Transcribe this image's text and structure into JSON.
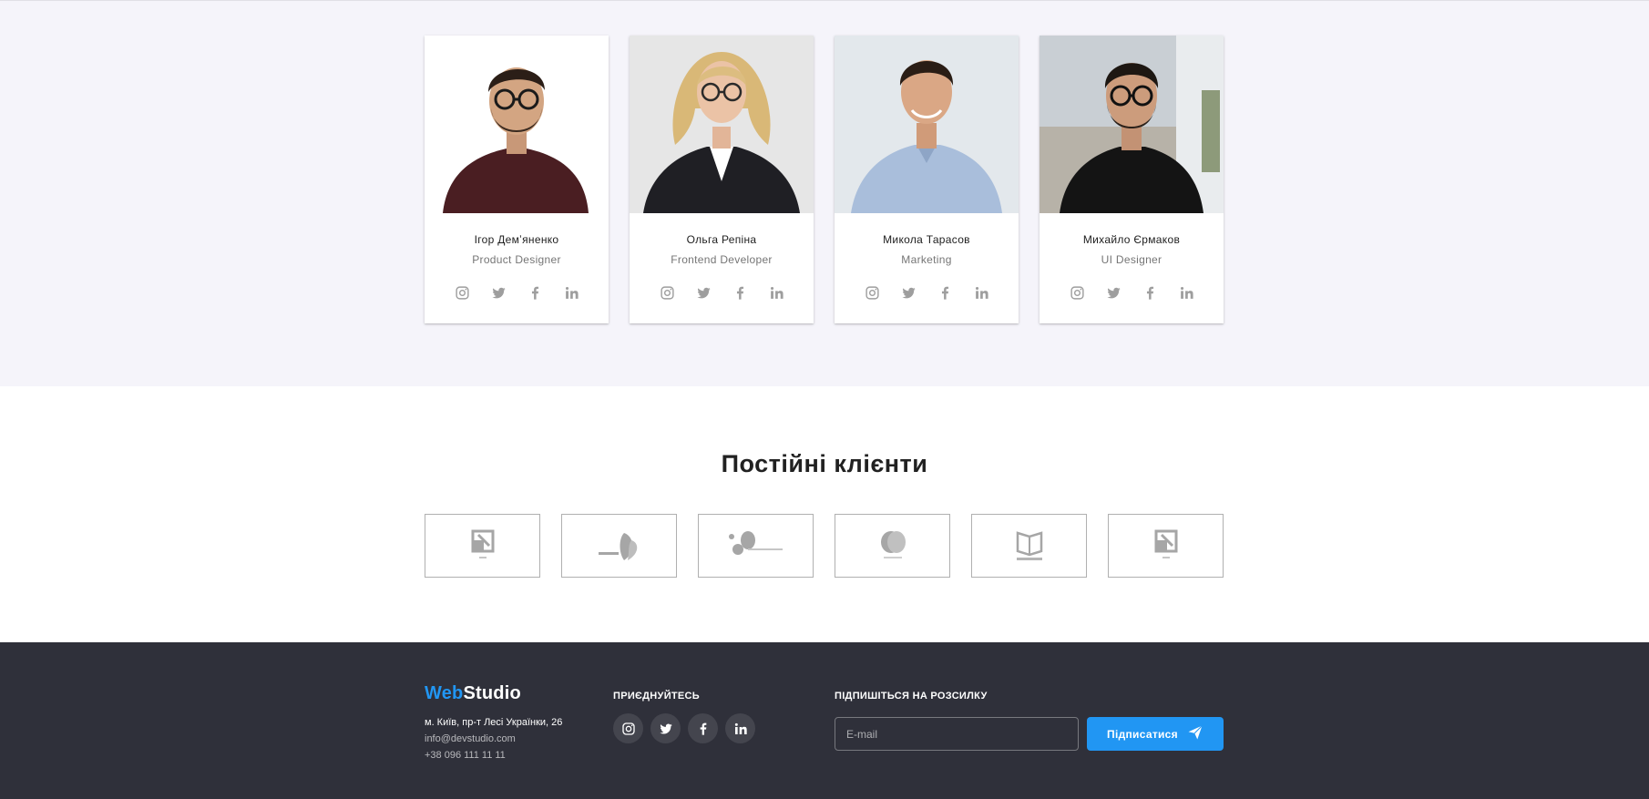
{
  "team": {
    "members": [
      {
        "name": "Ігор Демʼяненко",
        "role": "Product Designer"
      },
      {
        "name": "Ольга Репіна",
        "role": "Frontend Developer"
      },
      {
        "name": "Микола Тарасов",
        "role": "Marketing"
      },
      {
        "name": "Михайло Єрмаков",
        "role": "UI Designer"
      }
    ],
    "social_icons": [
      "instagram-icon",
      "twitter-icon",
      "facebook-icon",
      "linkedin-icon"
    ]
  },
  "clients": {
    "title": "Постійні клієнти",
    "logos": [
      "logo-maw",
      "logo-brand",
      "logo-blob",
      "logo-circles",
      "logo-company",
      "logo-maw"
    ]
  },
  "footer": {
    "logo_web": "Web",
    "logo_studio": "Studio",
    "address": "м. Київ, пр-т Лесі Українки, 26",
    "email": "info@devstudio.com",
    "phone": "+38 096 111 11 11",
    "join_title": "ПРИЄДНУЙТЕСЬ",
    "subscribe_title": "ПІДПИШІТЬСЯ НА РОЗСИЛКУ",
    "email_placeholder": "E-mail",
    "subscribe_button": "Підписатися"
  },
  "colors": {
    "accent": "#2196f3",
    "footer_bg": "#2f303a",
    "team_bg": "#f5f4fa",
    "muted_icon": "#9e9e9e"
  }
}
